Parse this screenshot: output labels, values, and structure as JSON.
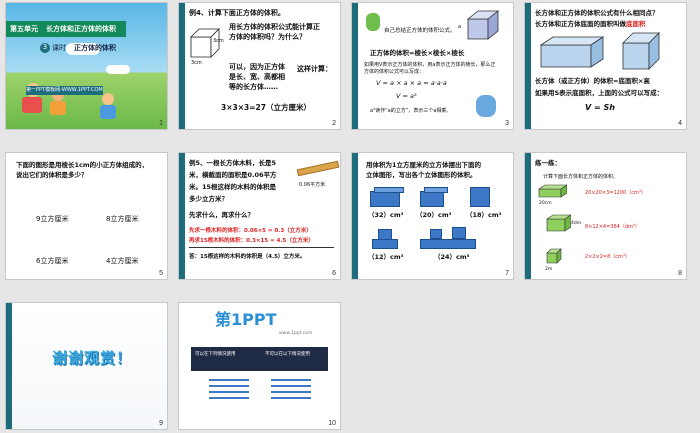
{
  "slides": {
    "s1": {
      "unit": "第五单元",
      "title": "长方体和正方体的体积",
      "lesson_badge": "3",
      "lesson_label": "课时",
      "subtitle": "正方体的体积",
      "website": "第一PPT模板网-WWW.1PPT.COM",
      "number": "1"
    },
    "s2": {
      "example": "例4、计算下面正方体的体积。",
      "question_l1": "用长方体的体积公式能计算正",
      "question_l2": "方体的体积吗？为什么？",
      "dim_top": "3cm",
      "dim_bottom": "3cm",
      "side_l1": "可以，因为正方体",
      "side_l2": "是长、宽、高都相",
      "side_l3": "等的长方体……",
      "calc_label": "这样计算：",
      "calc": "3×3×3=27（立方厘米）",
      "number": "2"
    },
    "s3": {
      "intro": "自己总结正方体的体积公式。",
      "formula_words": "正方体的体积=棱长×棱长×棱长",
      "desc_l1": "如果用V表示正方体的体积，用a表示正方体的棱长，那么正",
      "desc_l2": "方体的体积公式可以写成：",
      "formula_long": "V = a × a × a = a·a·a",
      "formula_short": "V = a³",
      "note": "a³读作“a的立方”，表示三个a相乘。",
      "edge": "a",
      "number": "3"
    },
    "s4": {
      "question": "长方体和正方体的体积公式有什么相同点？",
      "base_line_prefix": "长方体和正方体底面的面积叫做",
      "base_word": "底面积",
      "rule_l1": "长方体（或正方体）的体积=底面积×高",
      "rule_l2": "如果用S表示底面积，上面的公式可以写成：",
      "formula": "V = Sh",
      "number": "4"
    },
    "s5": {
      "intro_l1": "下面的图形是用棱长1cm的小正方体组成的，",
      "intro_l2": "说出它们的体积是多少？",
      "a": "9立方厘米",
      "b": "8立方厘米",
      "c": "6立方厘米",
      "d": "4立方厘米",
      "number": "5"
    },
    "s6": {
      "text_l1": "例5、一根长方体木料，长是5",
      "text_l2": "米，横截面的面积是0.06平方",
      "text_l3": "米。15根这样的木料的体积是",
      "text_l4": "多少立方米？",
      "area_label": "0.06平方米",
      "ask": "先求什么，再求什么？",
      "step1": "先求一根木料的体积：0.06×5 = 0.3（立方米）",
      "step2": "再求15根木料的体积：0.3×15 = 4.5（立方米）",
      "answer": "答：15根这样的木料的体积是（4.5）立方米。",
      "number": "6"
    },
    "s7": {
      "intro_l1": "用体积为1立方厘米的立方体摆出下面的",
      "intro_l2": "立体图形，写出各个立体图形的体积。",
      "v1": "（32）cm³",
      "v2": "（20）cm³",
      "v3": "（18）cm³",
      "v4": "（12）cm³",
      "v5": "（24）cm³",
      "number": "7"
    },
    "s8": {
      "title": "练一练：",
      "instruction": "计算下面长方体和正方体的体积。",
      "f1": "20×20×3=1200（cm³）",
      "f2": "8×12×4=384（dm³）",
      "f3": "2×2×2=8（cm³）",
      "d1": "20cm",
      "d2": "4dm",
      "d3": "2m",
      "number": "8"
    },
    "s9": {
      "thanks": "谢谢观赏！",
      "number": "9"
    },
    "s10": {
      "logo_num": "第1PPT",
      "logo_url": "www.1ppt.com",
      "col1_title": "可以在下列情况使用",
      "col2_title": "不可以在以下情况使用",
      "number": "10"
    }
  },
  "colors": {
    "teal": "#1d6d7d",
    "red": "#d22",
    "blue": "#3c78c5"
  }
}
